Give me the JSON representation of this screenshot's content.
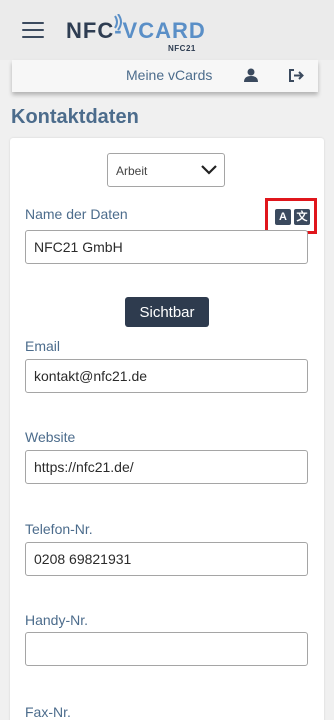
{
  "header": {
    "logo_main": "NFC-VCARD",
    "logo_sub": "NFC21"
  },
  "nav": {
    "my_vcards": "Meine vCards",
    "user_icon": "user-icon",
    "logout_icon": "sign-out-icon"
  },
  "page": {
    "title": "Kontaktdaten"
  },
  "form": {
    "type_select": {
      "selected": "Arbeit"
    },
    "translate_icons": [
      "A",
      "文"
    ],
    "visible_button": "Sichtbar",
    "fields": {
      "name": {
        "label": "Name der Daten",
        "value": "NFC21 GmbH"
      },
      "email": {
        "label": "Email",
        "value": "kontakt@nfc21.de"
      },
      "website": {
        "label": "Website",
        "value": "https://nfc21.de/"
      },
      "phone": {
        "label": "Telefon-Nr.",
        "value": "0208 69821931"
      },
      "mobile": {
        "label": "Handy-Nr.",
        "value": ""
      },
      "fax": {
        "label": "Fax-Nr."
      }
    }
  },
  "colors": {
    "accent": "#4c6c8c",
    "dark": "#2e3b4e",
    "highlight": "#e0161c"
  }
}
